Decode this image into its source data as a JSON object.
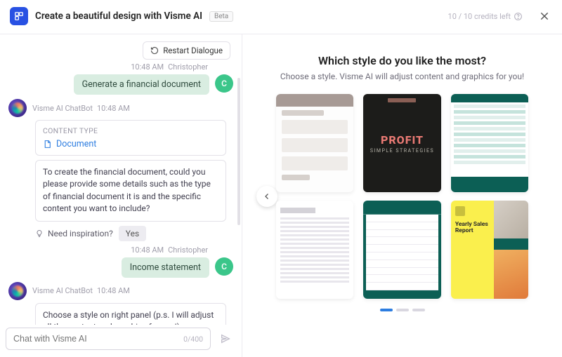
{
  "header": {
    "title": "Create a beautiful design with Visme AI",
    "badge": "Beta",
    "credits": "10 / 10 credits left"
  },
  "chat": {
    "restart_label": "Restart Dialogue",
    "input_placeholder": "Chat with Visme AI",
    "char_count": "0/400",
    "bot_name": "Visme AI ChatBot",
    "user_name": "Christopher",
    "user_initial": "C",
    "messages": {
      "m1": {
        "time": "10:48 AM",
        "text": "Generate a financial document"
      },
      "m2": {
        "time": "10:48 AM",
        "content_type_label": "CONTENT TYPE",
        "content_type_value": "Document",
        "text": "To create the financial document, could you please provide some details such as the type of financial document it is and the specific content you want to include?"
      },
      "inspiration": {
        "label": "Need inspiration?",
        "yes": "Yes"
      },
      "m3": {
        "time": "10:48 AM",
        "text": "Income statement"
      },
      "m4": {
        "time": "10:48 AM",
        "text": "Choose a style on right panel (p.s. I will adjust all the content and graphics for you!)"
      }
    }
  },
  "right": {
    "title": "Which style do you like the most?",
    "subtitle": "Choose a style. Visme AI will adjust content and graphics for you!",
    "profit_label": "PROFIT",
    "profit_sub": "SIMPLE STRATEGIES",
    "sales_report": "Yearly Sales Report"
  },
  "colors": {
    "accent": "#2d7de0",
    "user_bubble": "#d9ede1",
    "user_avatar": "#3bc68a",
    "logo": "#2851e3"
  }
}
